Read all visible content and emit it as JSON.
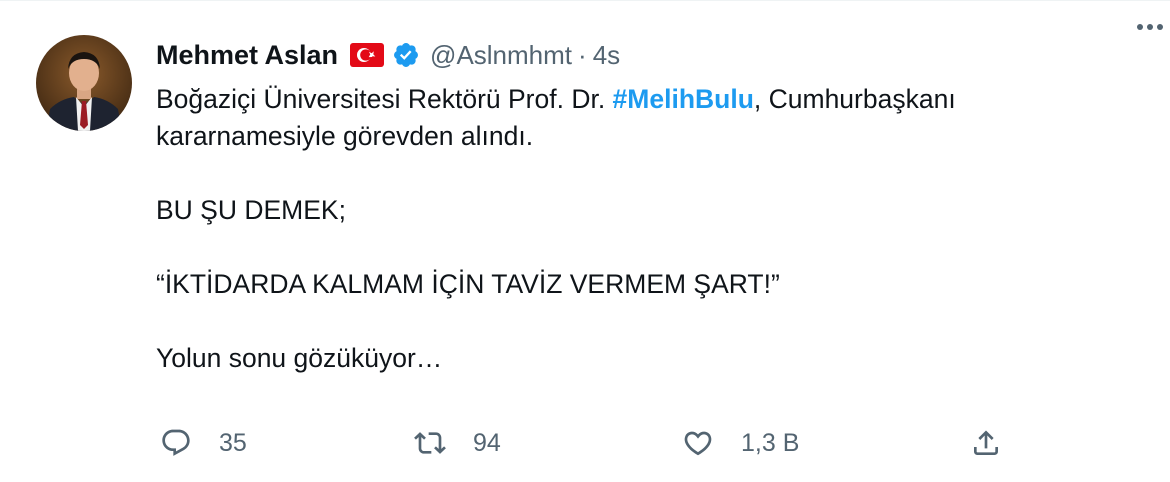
{
  "user": {
    "name": "Mehmet Aslan",
    "handle": "@Aslnmhmt",
    "separator": "·",
    "time": "4s",
    "flag_icon": "turkey-flag-icon",
    "verified_icon": "verified-badge-icon"
  },
  "tweet": {
    "line1_before": "Boğaziçi Üniversitesi Rektörü Prof. Dr. ",
    "hashtag": "#MelihBulu",
    "line1_after": ", Cumhurbaşkanı",
    "line2": "kararnamesiyle görevden alındı.",
    "para2": "BU ŞU DEMEK;",
    "para3": "“İKTİDARDA KALMAM İÇİN TAVİZ VERMEM ŞART!”",
    "para4": "Yolun sonu gözüküyor…"
  },
  "actions": {
    "reply_count": "35",
    "retweet_count": "94",
    "like_count": "1,3 B"
  },
  "colors": {
    "accent": "#1d9bf0",
    "text": "#0f1419",
    "secondary": "#536471",
    "flag_red": "#e30a17"
  }
}
